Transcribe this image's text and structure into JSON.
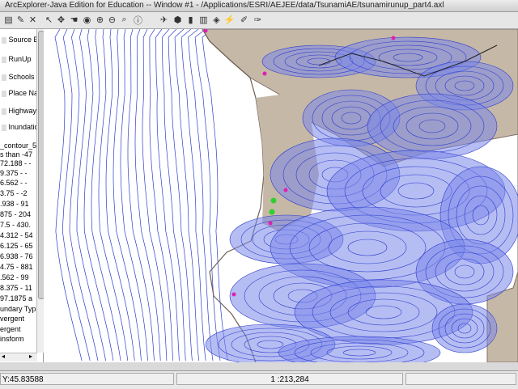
{
  "window": {
    "title": "ArcExplorer-Java Edition for Education -- Window #1 - /Applications/ESRI/AEJEE/data/TsunamiAE/tsunamirunup_part4.axl"
  },
  "toolbar": {
    "tools": [
      "add-layer",
      "open",
      "edit",
      "delete",
      "identify",
      "pan",
      "hand",
      "full-extent",
      "zoom-in",
      "zoom-out",
      "zoom-back",
      "info",
      "measure",
      "select",
      "find",
      "query",
      "buffer",
      "hyperlink",
      "label"
    ]
  },
  "toc": {
    "layers": [
      {
        "label": "Source Ev"
      },
      {
        "label": "RunUp"
      },
      {
        "label": "Schools"
      },
      {
        "label": "Place Nam"
      },
      {
        "label": "Highways"
      },
      {
        "label": "Inundation"
      }
    ],
    "legend": [
      "_contour_5",
      "s than -47",
      "72.188 - -",
      "9.375 - -",
      "6.562 - -",
      "3.75 - -2",
      ".938 - 91",
      "875 - 204",
      "7.5 - 430.",
      "4.312 - 54",
      "6.125 - 65",
      "6.938 - 76",
      "4.75 - 881",
      ".562 - 99",
      "8.375 - 11",
      "97.1875 a",
      "undary Typ",
      "vergent",
      "ergent",
      "insform"
    ]
  },
  "status": {
    "coordinates": "Y:45.83588",
    "scale": "1 :213,284",
    "extra": ""
  },
  "colors": {
    "land": "#c6b8a6",
    "contour": "#2c3ccc",
    "water_fill": "#7a86ea",
    "point": "#e020b0",
    "school": "#30d030"
  }
}
